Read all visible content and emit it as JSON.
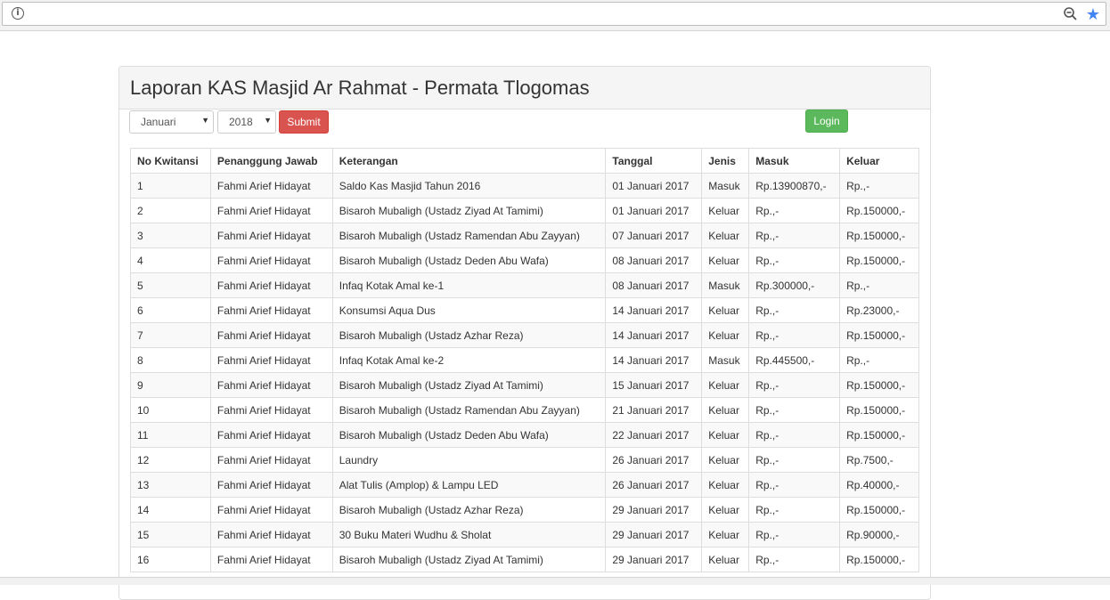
{
  "page": {
    "title": "Laporan KAS Masjid Ar Rahmat - Permata Tlogomas"
  },
  "filters": {
    "month": "Januari",
    "year": "2018",
    "submit_label": "Submit",
    "login_label": "Login"
  },
  "table": {
    "headers": [
      "No Kwitansi",
      "Penanggung Jawab",
      "Keterangan",
      "Tanggal",
      "Jenis",
      "Masuk",
      "Keluar"
    ],
    "rows": [
      [
        "1",
        "Fahmi Arief Hidayat",
        "Saldo Kas Masjid Tahun 2016",
        "01 Januari 2017",
        "Masuk",
        "Rp.13900870,-",
        "Rp.,-"
      ],
      [
        "2",
        "Fahmi Arief Hidayat",
        "Bisaroh Mubaligh (Ustadz Ziyad At Tamimi)",
        "01 Januari 2017",
        "Keluar",
        "Rp.,-",
        "Rp.150000,-"
      ],
      [
        "3",
        "Fahmi Arief Hidayat",
        "Bisaroh Mubaligh (Ustadz Ramendan Abu Zayyan)",
        "07 Januari 2017",
        "Keluar",
        "Rp.,-",
        "Rp.150000,-"
      ],
      [
        "4",
        "Fahmi Arief Hidayat",
        "Bisaroh Mubaligh (Ustadz Deden Abu Wafa)",
        "08 Januari 2017",
        "Keluar",
        "Rp.,-",
        "Rp.150000,-"
      ],
      [
        "5",
        "Fahmi Arief Hidayat",
        "Infaq Kotak Amal ke-1",
        "08 Januari 2017",
        "Masuk",
        "Rp.300000,-",
        "Rp.,-"
      ],
      [
        "6",
        "Fahmi Arief Hidayat",
        "Konsumsi Aqua Dus",
        "14 Januari 2017",
        "Keluar",
        "Rp.,-",
        "Rp.23000,-"
      ],
      [
        "7",
        "Fahmi Arief Hidayat",
        "Bisaroh Mubaligh (Ustadz Azhar Reza)",
        "14 Januari 2017",
        "Keluar",
        "Rp.,-",
        "Rp.150000,-"
      ],
      [
        "8",
        "Fahmi Arief Hidayat",
        "Infaq Kotak Amal ke-2",
        "14 Januari 2017",
        "Masuk",
        "Rp.445500,-",
        "Rp.,-"
      ],
      [
        "9",
        "Fahmi Arief Hidayat",
        "Bisaroh Mubaligh (Ustadz Ziyad At Tamimi)",
        "15 Januari 2017",
        "Keluar",
        "Rp.,-",
        "Rp.150000,-"
      ],
      [
        "10",
        "Fahmi Arief Hidayat",
        "Bisaroh Mubaligh (Ustadz Ramendan Abu Zayyan)",
        "21 Januari 2017",
        "Keluar",
        "Rp.,-",
        "Rp.150000,-"
      ],
      [
        "11",
        "Fahmi Arief Hidayat",
        "Bisaroh Mubaligh (Ustadz Deden Abu Wafa)",
        "22 Januari 2017",
        "Keluar",
        "Rp.,-",
        "Rp.150000,-"
      ],
      [
        "12",
        "Fahmi Arief Hidayat",
        "Laundry",
        "26 Januari 2017",
        "Keluar",
        "Rp.,-",
        "Rp.7500,-"
      ],
      [
        "13",
        "Fahmi Arief Hidayat",
        "Alat Tulis (Amplop) & Lampu LED",
        "26 Januari 2017",
        "Keluar",
        "Rp.,-",
        "Rp.40000,-"
      ],
      [
        "14",
        "Fahmi Arief Hidayat",
        "Bisaroh Mubaligh (Ustadz Azhar Reza)",
        "29 Januari 2017",
        "Keluar",
        "Rp.,-",
        "Rp.150000,-"
      ],
      [
        "15",
        "Fahmi Arief Hidayat",
        "30 Buku Materi Wudhu & Sholat",
        "29 Januari 2017",
        "Keluar",
        "Rp.,-",
        "Rp.90000,-"
      ],
      [
        "16",
        "Fahmi Arief Hidayat",
        "Bisaroh Mubaligh (Ustadz Ziyad At Tamimi)",
        "29 Januari 2017",
        "Keluar",
        "Rp.,-",
        "Rp.150000,-"
      ]
    ]
  },
  "colors": {
    "submit": "#d9534f",
    "login": "#5cb85c",
    "star": "#4285f4"
  }
}
